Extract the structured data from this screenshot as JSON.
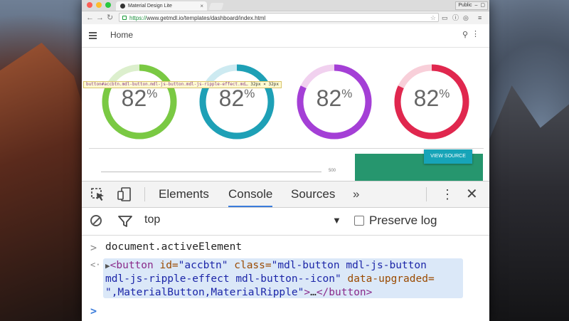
{
  "browser": {
    "tab_title": "Material Design Lite",
    "tab_close": "×",
    "profile_label": "Public",
    "url_scheme": "https://",
    "url_rest": "www.getmdl.io/templates/dashboard/index.html",
    "back_glyph": "←",
    "forward_glyph": "→",
    "reload_glyph": "↻",
    "star_glyph": "☆",
    "menu_glyph": "≡"
  },
  "page": {
    "title": "Home",
    "search_glyph": "⚲",
    "more_glyph": "⋮",
    "inspect_tooltip": "button#accbtn.mdl-button.mdl-js-button.mdl-js-ripple-effect.md…",
    "inspect_dims": "32px × 32px",
    "axis_label": "500",
    "view_source_label": "VIEW SOURCE",
    "gauges": [
      {
        "value": "82",
        "unit": "%",
        "fraction": 0.82,
        "color": "#7ac943",
        "track": "#dcefcd"
      },
      {
        "value": "82",
        "unit": "%",
        "fraction": 0.82,
        "color": "#1ea0b6",
        "track": "#cdeaf1"
      },
      {
        "value": "82",
        "unit": "%",
        "fraction": 0.82,
        "color": "#a43fd6",
        "track": "#f1d1ef"
      },
      {
        "value": "82",
        "unit": "%",
        "fraction": 0.82,
        "color": "#e0274e",
        "track": "#f8cfd9"
      }
    ]
  },
  "devtools": {
    "tabs": [
      "Elements",
      "Console",
      "Sources"
    ],
    "more_tabs": "»",
    "kebab": "⋮",
    "close": "✕",
    "context": "top",
    "context_arrow": "▼",
    "preserve_log": "Preserve log",
    "input_prompt": ">",
    "command": "document.activeElement",
    "output_prompt": "<·",
    "result_caret": "▶",
    "result": {
      "line1_tag_open": "<button",
      "line1_attr1": " id=",
      "line1_val1": "\"accbtn\"",
      "line1_attr2": " class=",
      "line1_val2": "\"mdl-button mdl-js-button",
      "line2_val": "mdl-js-ripple-effect mdl-button--icon\"",
      "line2_attr": " data-upgraded=",
      "line3_val": "\",MaterialButton,MaterialRipple\"",
      "line3_tag_close": ">",
      "line3_ellipsis": "…",
      "line3_end_tag": "</button>"
    },
    "cursor_prompt": ">"
  }
}
